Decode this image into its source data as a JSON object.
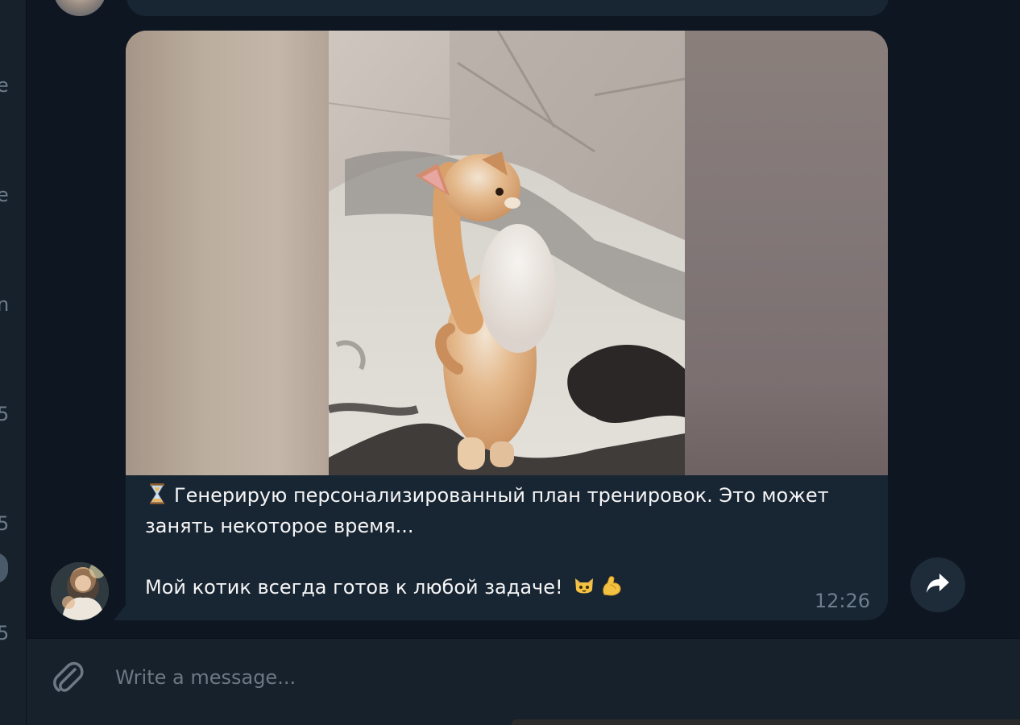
{
  "left_panel": {
    "fragments": [
      "e",
      "·",
      "e",
      "n",
      "5",
      "5",
      "5"
    ]
  },
  "message": {
    "caption_line1": "Генерирую персонализированный план тренировок. Это может занять некоторое время...",
    "caption_line2": "Мой котик всегда готов к любой задаче!",
    "time": "12:26",
    "icons": {
      "prefix": "hourglass-icon",
      "suffix": [
        "cat-face-icon",
        "flexed-biceps-icon"
      ]
    },
    "media": {
      "type": "video",
      "subject": "kitten standing on hind legs"
    }
  },
  "composer": {
    "placeholder": "Write a message..."
  },
  "actions": {
    "forward": "forward-arrow-icon",
    "attach": "paperclip-icon"
  },
  "colors": {
    "background": "#0e1621",
    "bubble": "#182533",
    "sidebar": "#17212b",
    "text": "#f5f5f5",
    "muted": "#6d7f8f"
  }
}
